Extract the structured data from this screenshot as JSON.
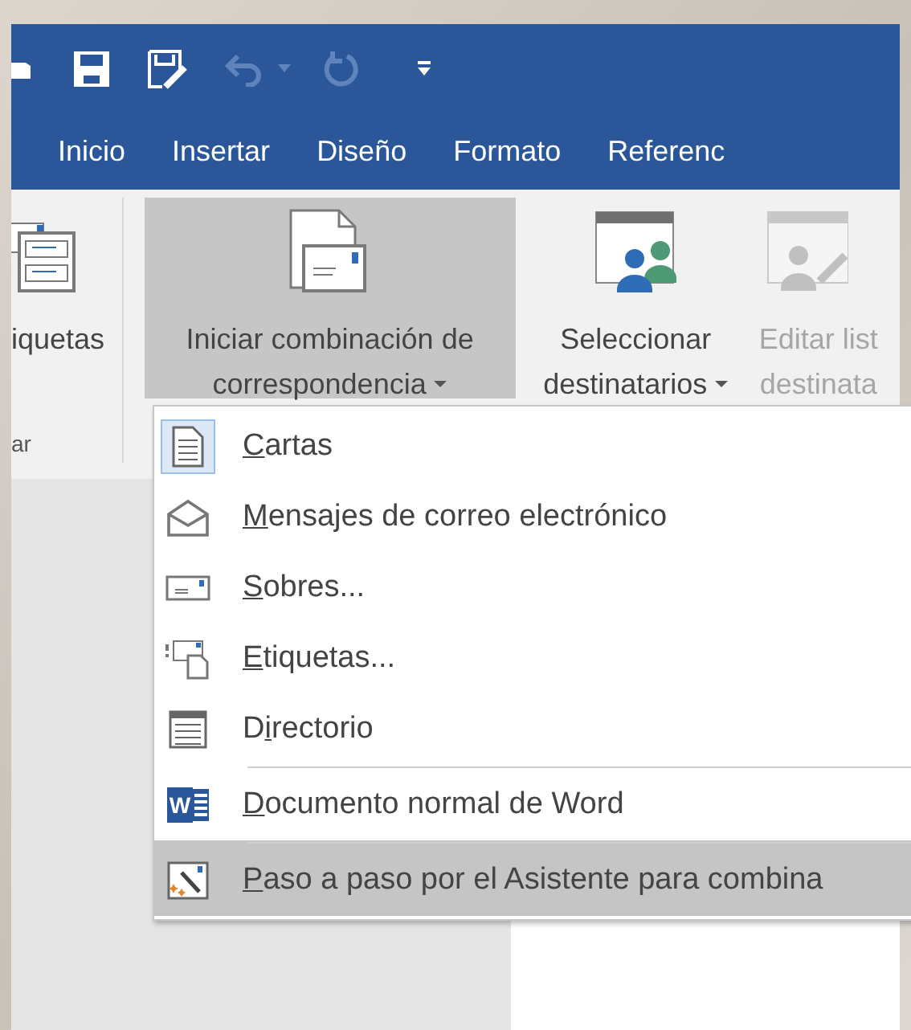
{
  "quick_access": [
    {
      "kind": "open",
      "disabled": false
    },
    {
      "kind": "save",
      "disabled": false
    },
    {
      "kind": "save_as",
      "disabled": false
    },
    {
      "kind": "undo",
      "disabled": true
    },
    {
      "kind": "undo_menu",
      "disabled": true
    },
    {
      "kind": "redo",
      "disabled": true
    },
    {
      "kind": "customize",
      "disabled": false
    }
  ],
  "tabs": [
    "Inicio",
    "Insertar",
    "Diseño",
    "Formato",
    "Referenc"
  ],
  "ribbon_buttons": [
    {
      "kind": "labels",
      "lines": [
        "iquetas"
      ],
      "pressed": false,
      "disabled": false,
      "dropdown": false
    },
    {
      "kind": "start_merge",
      "lines": [
        "Iniciar combinación de",
        "correspondencia"
      ],
      "pressed": true,
      "disabled": false,
      "dropdown": true
    },
    {
      "kind": "recipients",
      "lines": [
        "Seleccionar",
        "destinatarios"
      ],
      "pressed": false,
      "disabled": false,
      "dropdown": true
    },
    {
      "kind": "edit_list",
      "lines": [
        "Editar list",
        "destinata"
      ],
      "pressed": false,
      "disabled": true,
      "dropdown": false
    }
  ],
  "group_label": "ar",
  "menu": [
    {
      "kind": "letters",
      "key": "C",
      "after": "artas",
      "checked": true,
      "selected": false,
      "separator_before": false
    },
    {
      "kind": "email",
      "key": "M",
      "after": "ensajes de correo electrónico",
      "checked": false,
      "selected": false,
      "separator_before": false
    },
    {
      "kind": "envelopes",
      "key": "S",
      "after": "obres...",
      "checked": false,
      "selected": false,
      "separator_before": false
    },
    {
      "kind": "labels",
      "key": "E",
      "after": "tiquetas...",
      "checked": false,
      "selected": false,
      "separator_before": false
    },
    {
      "kind": "directory",
      "before": "D",
      "key": "i",
      "after": "rectorio",
      "checked": false,
      "selected": false,
      "separator_before": false
    },
    {
      "kind": "word",
      "icon_text": "W",
      "key": "D",
      "after": "ocumento normal de Word",
      "checked": false,
      "selected": false,
      "separator_before": true
    },
    {
      "kind": "wizard",
      "key": "P",
      "after": "aso a paso por el Asistente para combina",
      "checked": false,
      "selected": true,
      "separator_before": true
    }
  ]
}
